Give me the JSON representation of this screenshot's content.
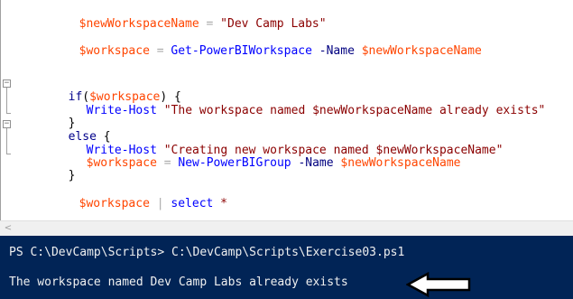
{
  "editor": {
    "line1": {
      "var": "$newWorkspaceName",
      "op": " = ",
      "str": "\"Dev Camp Labs\""
    },
    "line2": {
      "var": "$workspace",
      "op": " = ",
      "cmd": "Get-PowerBIWorkspace",
      "param": " -Name ",
      "var2": "$newWorkspaceName"
    },
    "line3": {
      "kw": "if",
      "open": "(",
      "var": "$workspace",
      "close": ") {"
    },
    "line4": {
      "cmd": "Write-Host",
      "str": " \"The workspace named $newWorkspaceName already exists\""
    },
    "line5": {
      "close": "}"
    },
    "line6": {
      "kw": "else",
      "open": " {"
    },
    "line7": {
      "cmd": "Write-Host",
      "str": " \"Creating new workspace named $newWorkspaceName\""
    },
    "line8": {
      "var": "$workspace",
      "op": " = ",
      "cmd": "New-PowerBIGroup",
      "param": " -Name ",
      "var2": "$newWorkspaceName"
    },
    "line9": {
      "close": "}"
    },
    "line10": {
      "var": "$workspace",
      "op": " | ",
      "cmd": "select",
      "star": " *"
    }
  },
  "console": {
    "prompt_line": "PS C:\\DevCamp\\Scripts> C:\\DevCamp\\Scripts\\Exercise03.ps1",
    "output_line": "The workspace named Dev Camp Labs already exists"
  },
  "icons": {
    "fold_minus": "−",
    "scroll_left": "<",
    "arrow": "arrow-left-icon"
  },
  "colors": {
    "variable": "#ff4500",
    "string": "#8b0000",
    "command": "#0000ff",
    "console_bg": "#012456"
  }
}
